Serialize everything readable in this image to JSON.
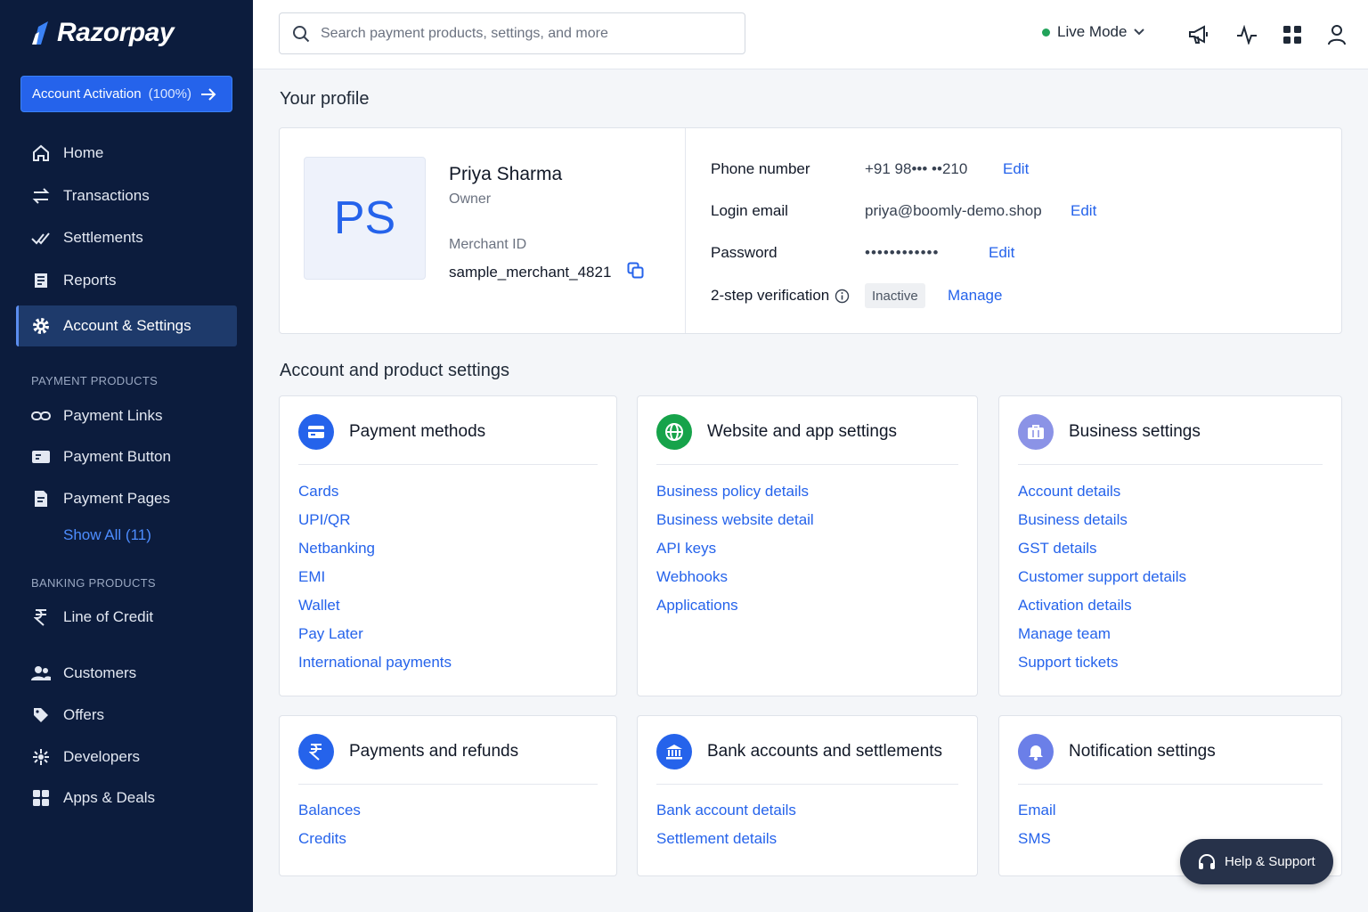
{
  "brand": {
    "name": "Razorpay"
  },
  "sidebar": {
    "activation": {
      "label": "Account Activation",
      "percent": "(100%)"
    },
    "items": [
      {
        "label": "Home",
        "icon": "home-icon"
      },
      {
        "label": "Transactions",
        "icon": "transactions-icon"
      },
      {
        "label": "Settlements",
        "icon": "settlements-icon"
      },
      {
        "label": "Reports",
        "icon": "reports-icon"
      },
      {
        "label": "Account & Settings",
        "icon": "gear-icon",
        "active": true
      }
    ],
    "payment_products_label": "PAYMENT PRODUCTS",
    "payment_products": [
      {
        "label": "Payment Links",
        "icon": "link-icon"
      },
      {
        "label": "Payment Button",
        "icon": "payment-button-icon"
      },
      {
        "label": "Payment Pages",
        "icon": "page-icon"
      }
    ],
    "show_all": "Show All (11)",
    "banking_products_label": "BANKING PRODUCTS",
    "banking_products": [
      {
        "label": "Line of Credit",
        "icon": "rupee-icon"
      }
    ],
    "other_items": [
      {
        "label": "Customers",
        "icon": "customers-icon"
      },
      {
        "label": "Offers",
        "icon": "tag-icon"
      },
      {
        "label": "Developers",
        "icon": "developers-icon"
      },
      {
        "label": "Apps & Deals",
        "icon": "apps-icon"
      }
    ]
  },
  "topbar": {
    "search_placeholder": "Search payment products, settings, and more",
    "mode_label": "Live Mode",
    "mode_color": "#22a35a"
  },
  "profile": {
    "section_title": "Your profile",
    "initials": "PS",
    "name": "Priya Sharma",
    "role": "Owner",
    "merchant_id_label": "Merchant ID",
    "merchant_id": "sample_merchant_4821",
    "phone_label": "Phone number",
    "phone_value": "+91 98••• ••210",
    "email_label": "Login email",
    "email_value": "priya@boomly-demo.shop",
    "password_label": "Password",
    "password_value": "••••••••••••",
    "twofa_label": "2-step verification",
    "twofa_status": "Inactive",
    "edit_label": "Edit",
    "manage_label": "Manage"
  },
  "settings": {
    "section_title": "Account and product settings",
    "cards": [
      {
        "title": "Payment methods",
        "icon": "card-icon",
        "icon_color": "#2563eb",
        "links": [
          "Cards",
          "UPI/QR",
          "Netbanking",
          "EMI",
          "Wallet",
          "Pay Later",
          "International payments"
        ]
      },
      {
        "title": "Website and app settings",
        "icon": "globe-icon",
        "icon_color": "#16a34a",
        "links": [
          "Business policy details",
          "Business website detail",
          "API keys",
          "Webhooks",
          "Applications"
        ]
      },
      {
        "title": "Business settings",
        "icon": "briefcase-icon",
        "icon_color": "#8b93e6",
        "links": [
          "Account details",
          "Business details",
          "GST details",
          "Customer support details",
          "Activation details",
          "Manage team",
          "Support tickets"
        ]
      },
      {
        "title": "Payments and refunds",
        "icon": "rupee-circle-icon",
        "icon_color": "#2563eb",
        "links": [
          "Balances",
          "Credits"
        ]
      },
      {
        "title": "Bank accounts and settlements",
        "icon": "bank-icon",
        "icon_color": "#2563eb",
        "links": [
          "Bank account details",
          "Settlement details"
        ]
      },
      {
        "title": "Notification settings",
        "icon": "bell-icon",
        "icon_color": "#6b7fe8",
        "links": [
          "Email",
          "SMS"
        ]
      }
    ]
  },
  "help": {
    "label": "Help & Support"
  }
}
